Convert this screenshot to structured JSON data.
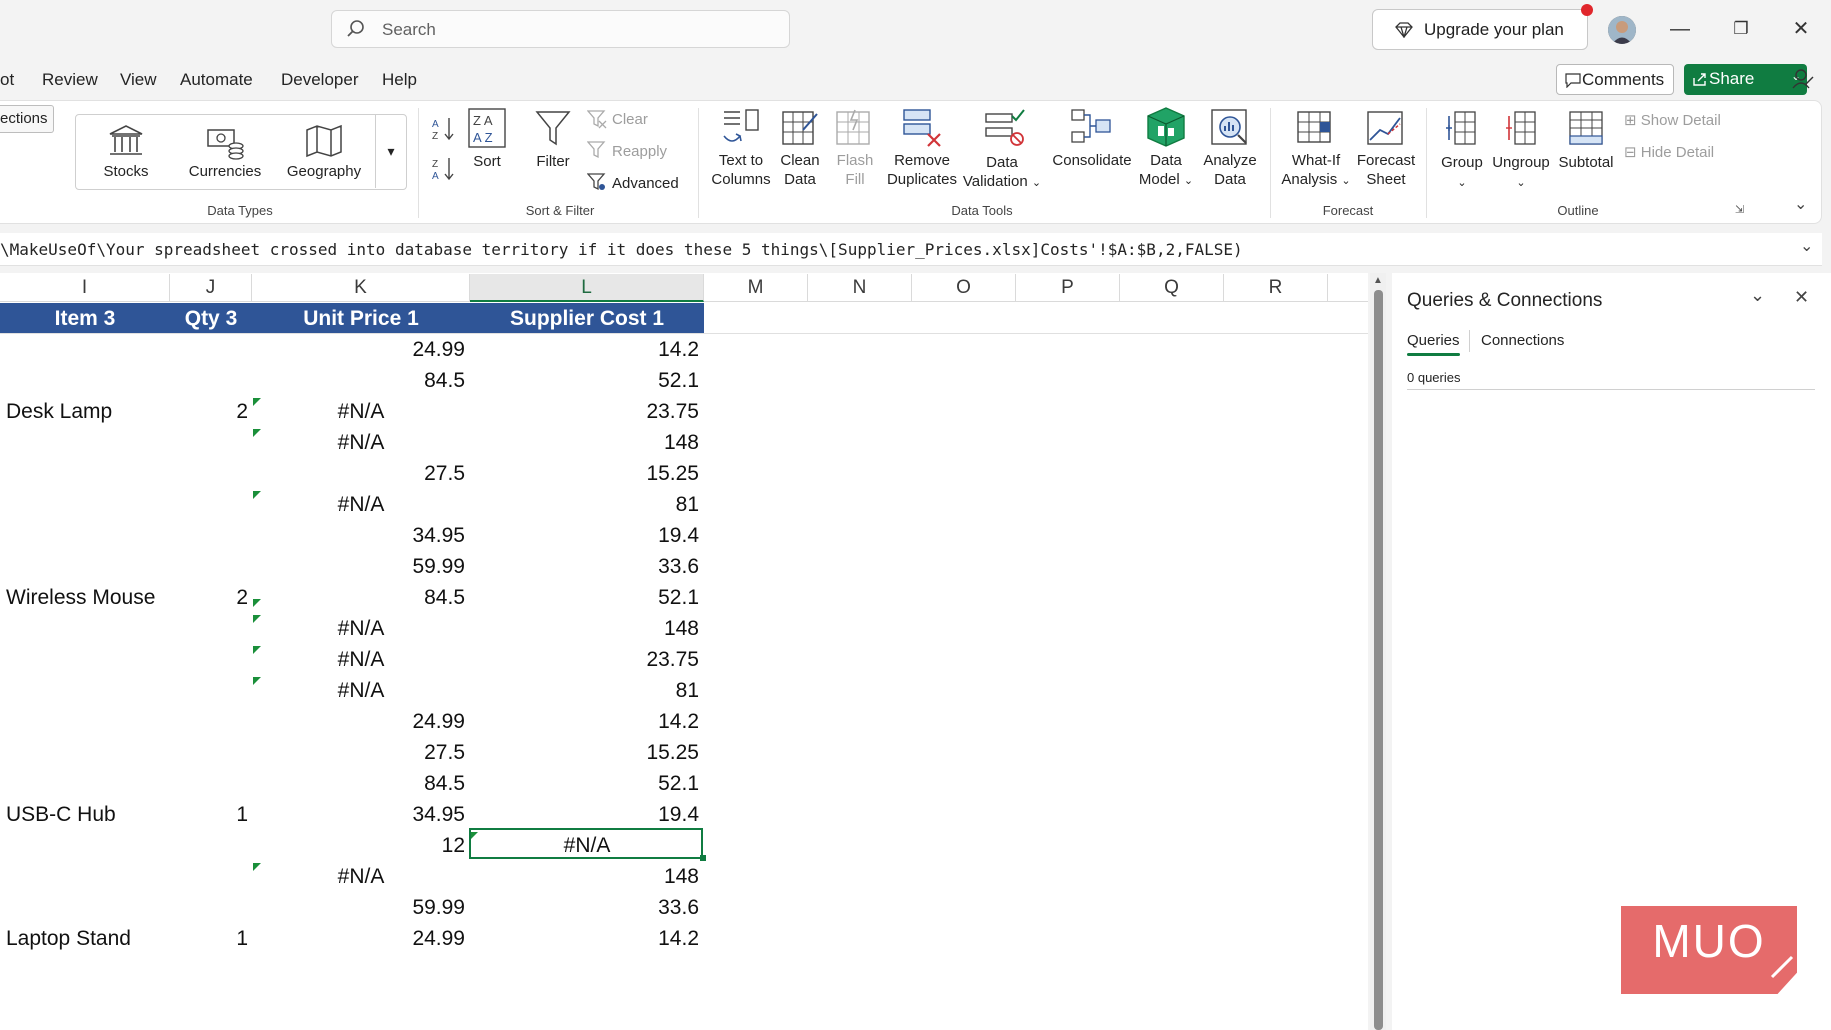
{
  "search": {
    "placeholder": "Search"
  },
  "titlebar": {
    "upgrade_label": "Upgrade your plan"
  },
  "menu": {
    "items": [
      "ot",
      "Review",
      "View",
      "Automate",
      "Developer",
      "Help"
    ],
    "comments": "Comments",
    "share": "Share"
  },
  "ribbon": {
    "connections_fragment": "ections",
    "data_types": {
      "items": [
        "Stocks",
        "Currencies",
        "Geography"
      ],
      "group": "Data Types"
    },
    "sort_filter": {
      "sort": "Sort",
      "filter": "Filter",
      "clear": "Clear",
      "reapply": "Reapply",
      "advanced": "Advanced",
      "group": "Sort & Filter"
    },
    "data_tools": {
      "text_to_columns": [
        "Text to",
        "Columns"
      ],
      "clean_data": [
        "Clean",
        "Data"
      ],
      "flash_fill": [
        "Flash",
        "Fill"
      ],
      "remove_duplicates": [
        "Remove",
        "Duplicates"
      ],
      "data_validation": [
        "Data",
        "Validation"
      ],
      "consolidate": "Consolidate",
      "data_model": [
        "Data",
        "Model"
      ],
      "analyze_data": [
        "Analyze",
        "Data"
      ],
      "group": "Data Tools"
    },
    "forecast": {
      "what_if": [
        "What-If",
        "Analysis"
      ],
      "forecast_sheet": [
        "Forecast",
        "Sheet"
      ],
      "group": "Forecast"
    },
    "outline": {
      "group_btn": "Group",
      "ungroup": "Ungroup",
      "subtotal": "Subtotal",
      "show_detail": "Show Detail",
      "hide_detail": "Hide Detail",
      "group": "Outline"
    }
  },
  "formula": "\\MakeUseOf\\Your spreadsheet crossed into database territory if it does these 5 things\\[Supplier_Prices.xlsx]Costs'!$A:$B,2,FALSE)",
  "columns": [
    "I",
    "J",
    "K",
    "L",
    "M",
    "N",
    "O",
    "P",
    "Q",
    "R"
  ],
  "headers": {
    "item": "Item 3",
    "qty": "Qty 3",
    "unit_price": "Unit Price 1",
    "supplier_cost": "Supplier Cost 1"
  },
  "rows": [
    {
      "item": "",
      "qty": "",
      "price": "24.99",
      "cost": "14.2"
    },
    {
      "item": "",
      "qty": "",
      "price": "84.5",
      "cost": "52.1"
    },
    {
      "item": "Desk Lamp",
      "qty": "2",
      "price": "#N/A",
      "cost": "23.75"
    },
    {
      "item": "",
      "qty": "",
      "price": "#N/A",
      "cost": "148"
    },
    {
      "item": "",
      "qty": "",
      "price": "27.5",
      "cost": "15.25"
    },
    {
      "item": "",
      "qty": "",
      "price": "#N/A",
      "cost": "81"
    },
    {
      "item": "",
      "qty": "",
      "price": "34.95",
      "cost": "19.4"
    },
    {
      "item": "",
      "qty": "",
      "price": "59.99",
      "cost": "33.6"
    },
    {
      "item": "Wireless Mouse",
      "qty": "2",
      "price": "84.5",
      "cost": "52.1"
    },
    {
      "item": "",
      "qty": "",
      "price": "#N/A",
      "cost": "148"
    },
    {
      "item": "",
      "qty": "",
      "price": "#N/A",
      "cost": "23.75"
    },
    {
      "item": "",
      "qty": "",
      "price": "#N/A",
      "cost": "81"
    },
    {
      "item": "",
      "qty": "",
      "price": "24.99",
      "cost": "14.2"
    },
    {
      "item": "",
      "qty": "",
      "price": "27.5",
      "cost": "15.25"
    },
    {
      "item": "",
      "qty": "",
      "price": "84.5",
      "cost": "52.1"
    },
    {
      "item": "USB-C Hub",
      "qty": "1",
      "price": "34.95",
      "cost": "19.4"
    },
    {
      "item": "",
      "qty": "",
      "price": "12",
      "cost": "#N/A"
    },
    {
      "item": "",
      "qty": "",
      "price": "#N/A",
      "cost": "148"
    },
    {
      "item": "",
      "qty": "",
      "price": "59.99",
      "cost": "33.6"
    },
    {
      "item": "Laptop Stand",
      "qty": "1",
      "price": "24.99",
      "cost": "14.2"
    }
  ],
  "pane": {
    "title": "Queries & Connections",
    "tab_queries": "Queries",
    "tab_connections": "Connections",
    "count": "0 queries"
  },
  "watermark": "MUO",
  "colors": {
    "accent": "#107c41",
    "header_fill": "#2f5597",
    "logo": "#e56b6b"
  }
}
